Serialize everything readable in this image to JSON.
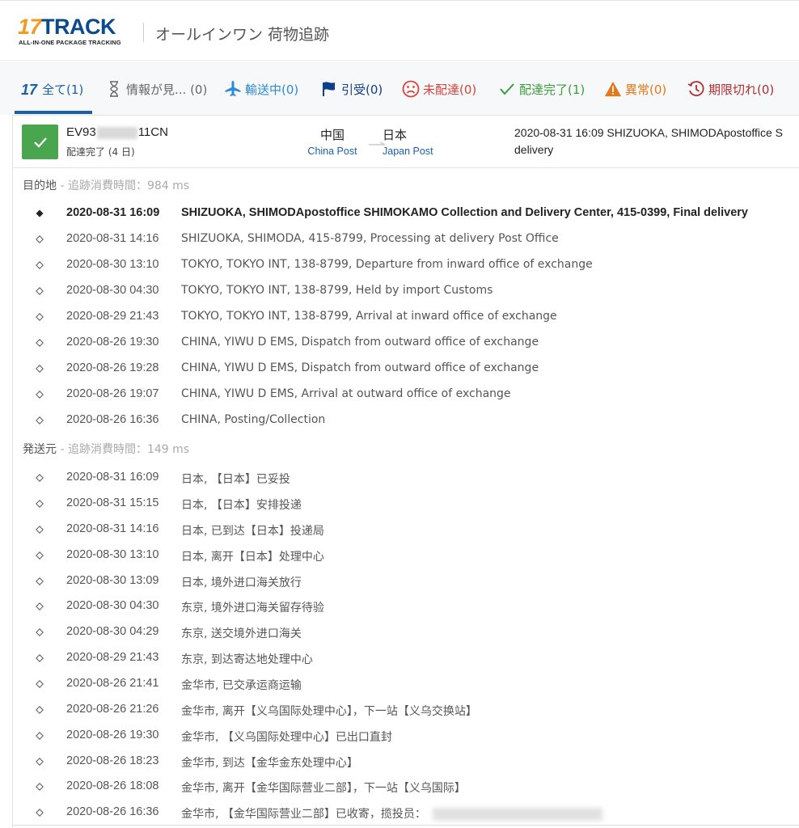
{
  "header": {
    "logo_num": "17",
    "logo_word": "TRACK",
    "logo_tagline": "ALL-IN-ONE PACKAGE TRACKING",
    "title": "オールインワン 荷物追跡"
  },
  "tabs": [
    {
      "label": "全て(1)",
      "icon": "seventeen-logo-icon",
      "color": "#1a5fa8"
    },
    {
      "label": "情報が見... (0)",
      "icon": "hourglass-icon",
      "color": "#666666"
    },
    {
      "label": "輸送中(0)",
      "icon": "airplane-icon",
      "color": "#2d8ad6"
    },
    {
      "label": "引受(0)",
      "icon": "flag-icon",
      "color": "#0e3e8c"
    },
    {
      "label": "未配達(0)",
      "icon": "sad-face-icon",
      "color": "#d9413b"
    },
    {
      "label": "配達完了(1)",
      "icon": "checkmark-icon",
      "color": "#3a9d3a"
    },
    {
      "label": "異常(0)",
      "icon": "warning-icon",
      "color": "#e77817"
    },
    {
      "label": "期限切れ(0)",
      "icon": "history-clock-icon",
      "color": "#b22f2f"
    }
  ],
  "package": {
    "number_prefix": "EV93",
    "number_suffix": "11CN",
    "status": "配達完了 (4 日)",
    "origin_country": "中国",
    "origin_carrier": "China Post",
    "dest_country": "日本",
    "dest_carrier": "Japan Post",
    "latest_line1": "2020-08-31 16:09  SHIZUOKA, SHIMODApostoffice S",
    "latest_line2": "delivery",
    "status_color": "#4aa64e"
  },
  "destination": {
    "label": "目的地",
    "time": " - 追跡消費時間：984 ms",
    "events": [
      {
        "time": "2020-08-31 16:09",
        "desc": "SHIZUOKA, SHIMODApostoffice SHIMOKAMO Collection and Delivery Center, 415-0399, Final delivery"
      },
      {
        "time": "2020-08-31 14:16",
        "desc": "SHIZUOKA, SHIMODA, 415-8799, Processing at delivery Post Office"
      },
      {
        "time": "2020-08-30 13:10",
        "desc": "TOKYO, TOKYO INT, 138-8799, Departure from inward office of exchange"
      },
      {
        "time": "2020-08-30 04:30",
        "desc": "TOKYO, TOKYO INT, 138-8799, Held by import Customs"
      },
      {
        "time": "2020-08-29 21:43",
        "desc": "TOKYO, TOKYO INT, 138-8799, Arrival at inward office of exchange"
      },
      {
        "time": "2020-08-26 19:30",
        "desc": "CHINA, YIWU D EMS, Dispatch from outward office of exchange"
      },
      {
        "time": "2020-08-26 19:28",
        "desc": "CHINA, YIWU D EMS, Dispatch from outward office of exchange"
      },
      {
        "time": "2020-08-26 19:07",
        "desc": "CHINA, YIWU D EMS, Arrival at outward office of exchange"
      },
      {
        "time": "2020-08-26 16:36",
        "desc": "CHINA, Posting/Collection"
      }
    ]
  },
  "origin": {
    "label": "発送元",
    "time": " - 追跡消費時間：149 ms",
    "events": [
      {
        "time": "2020-08-31 16:09",
        "desc": "日本, 【日本】已妥投"
      },
      {
        "time": "2020-08-31 15:15",
        "desc": "日本, 【日本】安排投递"
      },
      {
        "time": "2020-08-31 14:16",
        "desc": "日本, 已到达【日本】投递局"
      },
      {
        "time": "2020-08-30 13:10",
        "desc": "日本, 离开【日本】处理中心"
      },
      {
        "time": "2020-08-30 13:09",
        "desc": "日本, 境外进口海关放行"
      },
      {
        "time": "2020-08-30 04:30",
        "desc": "东京, 境外进口海关留存待验"
      },
      {
        "time": "2020-08-30 04:29",
        "desc": "东京, 送交境外进口海关"
      },
      {
        "time": "2020-08-29 21:43",
        "desc": "东京, 到达寄达地处理中心"
      },
      {
        "time": "2020-08-26 21:41",
        "desc": "金华市, 已交承运商运输"
      },
      {
        "time": "2020-08-26 21:26",
        "desc": "金华市, 离开【义乌国际处理中心】，下一站【义乌交换站】"
      },
      {
        "time": "2020-08-26 19:30",
        "desc": "金华市, 【义乌国际处理中心】已出口直封"
      },
      {
        "time": "2020-08-26 18:23",
        "desc": "金华市, 到达【金华金东处理中心】"
      },
      {
        "time": "2020-08-26 18:08",
        "desc": "金华市, 离开【金华国际营业二部】，下一站【义乌国际】"
      },
      {
        "time": "2020-08-26 16:36",
        "desc": "金华市, 【金华国际营业二部】已收寄，揽投员："
      }
    ]
  }
}
